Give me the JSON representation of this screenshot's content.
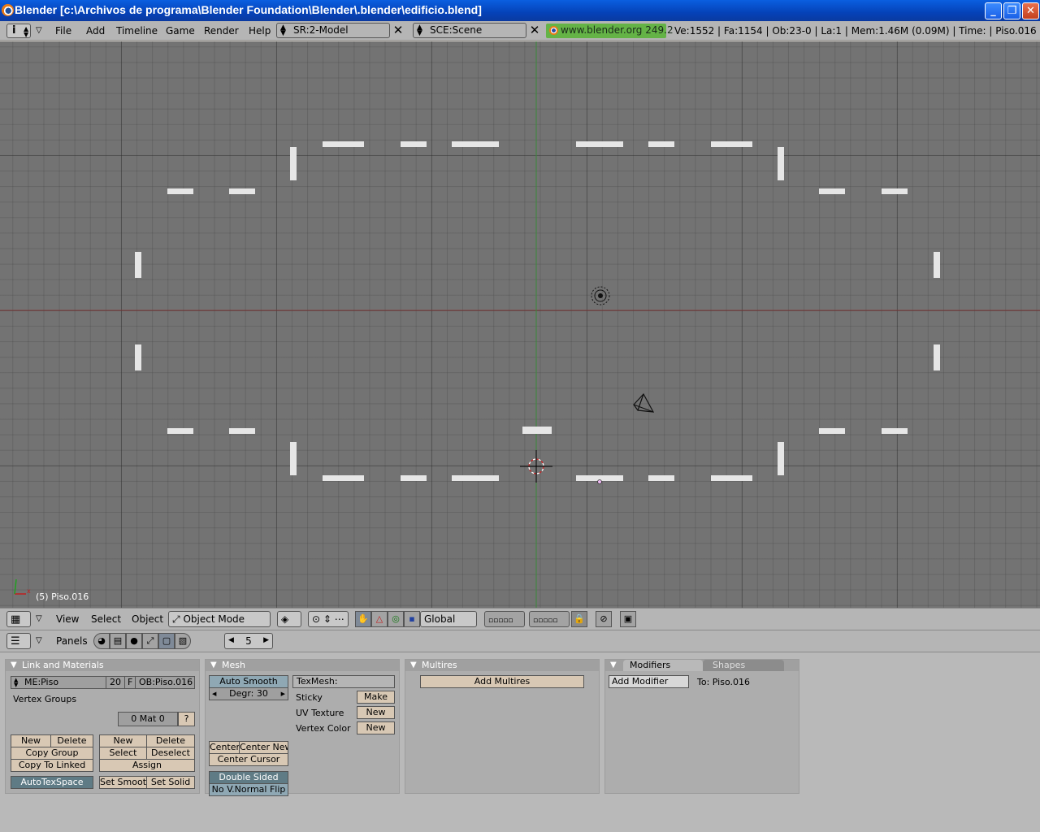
{
  "window": {
    "title": "Blender [c:\\Archivos de programa\\Blender Foundation\\Blender\\.blender\\edificio.blend]",
    "minimize_icon": "minimize-icon",
    "maximize_icon": "maximize-icon",
    "close_icon": "close-icon"
  },
  "infobar": {
    "menus": [
      "File",
      "Add",
      "Timeline",
      "Game",
      "Render",
      "Help"
    ],
    "screen_field": "SR:2-Model",
    "scene_field": "SCE:Scene",
    "website": "www.blender.org 249.2",
    "stats": "Ve:1552 | Fa:1154 | Ob:23-0 | La:1  | Mem:1.46M (0.09M)  | Time: | Piso.016"
  },
  "viewport": {
    "object_label": "(5) Piso.016",
    "axis_x_color": "#7f3a3a",
    "axis_y_color": "#3a8a3a"
  },
  "view3d_header": {
    "menus": [
      "View",
      "Select",
      "Object"
    ],
    "mode": "Object Mode",
    "orientation": "Global"
  },
  "buttons_header": {
    "panels_label": "Panels",
    "frame": "5"
  },
  "link_materials": {
    "title": "Link and Materials",
    "mesh_name": "ME:Piso",
    "users": "20",
    "fake": "F",
    "object_name": "OB:Piso.016",
    "vertex_groups": "Vertex Groups",
    "mat": "0 Mat 0",
    "mat_help": "?",
    "new": "New",
    "delete": "Delete",
    "copy_group": "Copy Group",
    "copy_to_linked": "Copy To Linked",
    "new2": "New",
    "delete2": "Delete",
    "select": "Select",
    "deselect": "Deselect",
    "assign": "Assign",
    "autotexspace": "AutoTexSpace",
    "set_smooth": "Set Smoot",
    "set_solid": "Set Solid"
  },
  "mesh": {
    "title": "Mesh",
    "auto_smooth": "Auto Smooth",
    "degr": "Degr: 30",
    "texmesh": "TexMesh:",
    "sticky": "Sticky",
    "make": "Make",
    "uv_texture": "UV Texture",
    "uv_new": "New",
    "vertex_color": "Vertex Color",
    "vc_new": "New",
    "center": "Center",
    "center_new": "Center New",
    "center_cursor": "Center Cursor",
    "double_sided": "Double Sided",
    "no_vnormal_flip": "No V.Normal Flip"
  },
  "multires": {
    "title": "Multires",
    "add": "Add Multires"
  },
  "modifiers": {
    "tab_modifiers": "Modifiers",
    "tab_shapes": "Shapes",
    "add_modifier": "Add Modifier",
    "to": "To: Piso.016"
  }
}
